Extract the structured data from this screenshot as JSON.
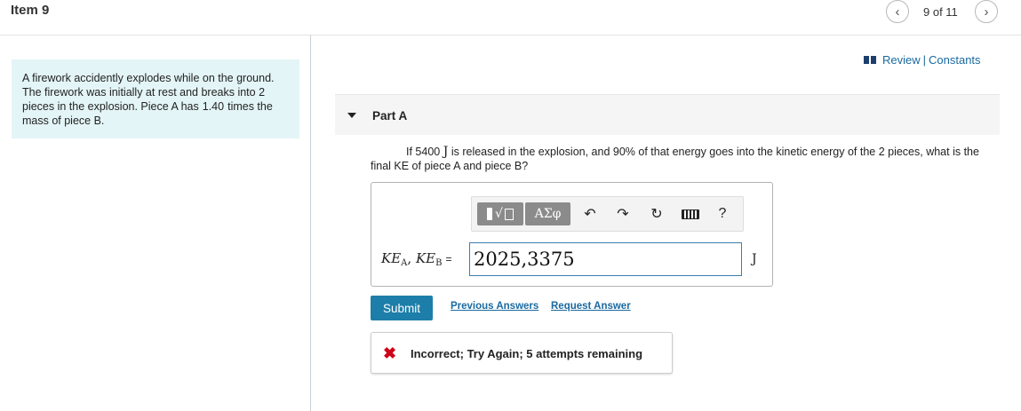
{
  "header": {
    "item_title": "Item 9",
    "page_count": "9 of 11",
    "prev_icon": "chevron-left-icon",
    "next_icon": "chevron-right-icon"
  },
  "problem": {
    "text_before": "A firework accidently explodes while on the ground. The firework was initially at rest and breaks into 2 pieces in the explosion. Piece A has",
    "mass_ratio": "1.40",
    "text_after": "times the mass of piece B."
  },
  "links": {
    "review": "Review",
    "separator": "|",
    "constants": "Constants"
  },
  "part": {
    "label": "Part A"
  },
  "question": {
    "before": "If 5400",
    "unit": "J",
    "after": "is released in the explosion, and 90% of that energy goes into the kinetic energy of the 2 pieces, what is the final KE of piece A and piece B?"
  },
  "toolbar": {
    "greek_label": "ΑΣφ",
    "undo_symbol": "↶",
    "redo_symbol": "↷",
    "reset_symbol": "↻",
    "help_label": "?"
  },
  "answer": {
    "var1": "KE",
    "sub1": "A",
    "comma": ",",
    "var2": "KE",
    "sub2": "B",
    "equals": "=",
    "value": "2025,3375",
    "unit": "J"
  },
  "actions": {
    "submit_label": "Submit",
    "previous_answers_label": "Previous Answers",
    "request_answer_label": "Request Answer"
  },
  "feedback": {
    "icon": "x-icon",
    "icon_symbol": "✖",
    "message": "Incorrect; Try Again; 5 attempts remaining",
    "color": "#d0021b"
  },
  "colors": {
    "accent": "#1d7ea9",
    "link": "#1a6aa0",
    "problem_bg": "#e4f5f7"
  }
}
